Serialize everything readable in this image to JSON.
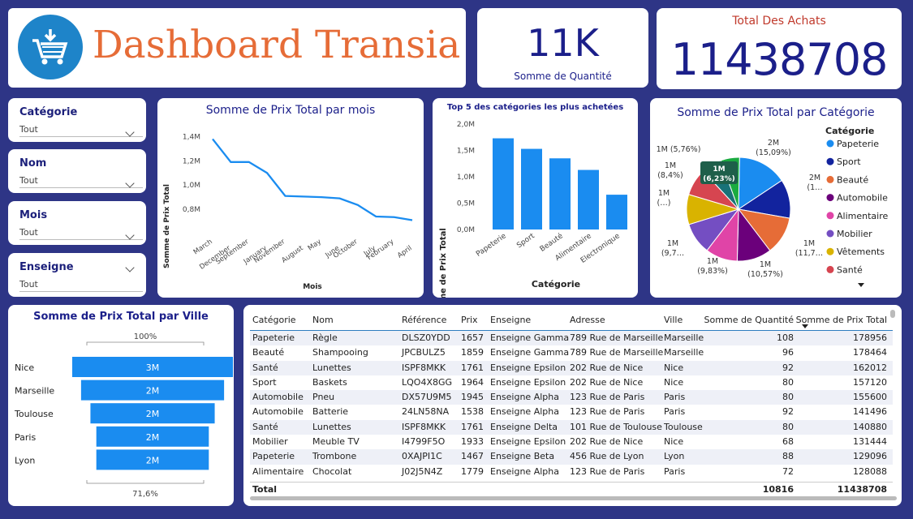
{
  "header": {
    "title": "Dashboard Transia",
    "icon": "shopping-cart-download-icon"
  },
  "kpi_quantity": {
    "value": "11K",
    "label": "Somme de Quantité"
  },
  "kpi_total": {
    "label": "Total Des Achats",
    "value": "11438708"
  },
  "slicers": [
    {
      "title": "Catégorie",
      "value": "Tout"
    },
    {
      "title": "Nom",
      "value": "Tout"
    },
    {
      "title": "Mois",
      "value": "Tout"
    },
    {
      "title": "Enseigne",
      "value": "Tout"
    }
  ],
  "line_chart": {
    "title": "Somme de Prix Total par mois",
    "ylabel": "Somme de Prix Total",
    "xlabel": "Mois",
    "yticks": [
      "1,4M",
      "1,2M",
      "1,0M",
      "0,8M"
    ],
    "categories": [
      "March",
      "December",
      "September",
      "January",
      "November",
      "August",
      "May",
      "June",
      "October",
      "July",
      "February",
      "April"
    ]
  },
  "bar_chart": {
    "title": "Top 5 des catégories les plus achetées",
    "ylabel": "Somme de Prix Total",
    "xlabel": "Catégorie",
    "yticks": [
      "2,0M",
      "1,5M",
      "1,0M",
      "0,5M",
      "0,0M"
    ],
    "color": "#1a8cf0"
  },
  "pie_chart": {
    "title": "Somme de Prix Total par Catégorie",
    "legend_title": "Catégorie",
    "labels": [
      "2M\n(15,09%)",
      "2M\n(1…",
      "1M\n(11,7…",
      "1M\n(10,57%)",
      "1M\n(9,83%)",
      "1M\n(9,7…",
      "1M\n(…)",
      "1M\n(8,4%)",
      "1M (5,76%)"
    ],
    "tooltip_line1": "1M",
    "tooltip_line2": "(6,23%)"
  },
  "funnel": {
    "title": "Somme de Prix Total par Ville",
    "top_pct": "100%",
    "bottom_pct": "71,6%",
    "color": "#1a8cf0"
  },
  "table": {
    "headers": [
      "Catégorie",
      "Nom",
      "Référence",
      "Prix",
      "Enseigne",
      "Adresse",
      "Ville",
      "Somme de Quantité",
      "Somme de Prix Total"
    ],
    "rows": [
      [
        "Papeterie",
        "Règle",
        "DLSZ0YDD",
        "1657",
        "Enseigne Gamma",
        "789 Rue de Marseille",
        "Marseille",
        "108",
        "178956"
      ],
      [
        "Beauté",
        "Shampooing",
        "JPCBULZ5",
        "1859",
        "Enseigne Gamma",
        "789 Rue de Marseille",
        "Marseille",
        "96",
        "178464"
      ],
      [
        "Santé",
        "Lunettes",
        "ISPF8MKK",
        "1761",
        "Enseigne Epsilon",
        "202 Rue de Nice",
        "Nice",
        "92",
        "162012"
      ],
      [
        "Sport",
        "Baskets",
        "LQO4X8GG",
        "1964",
        "Enseigne Epsilon",
        "202 Rue de Nice",
        "Nice",
        "80",
        "157120"
      ],
      [
        "Automobile",
        "Pneu",
        "DX57U9M5",
        "1945",
        "Enseigne Alpha",
        "123 Rue de Paris",
        "Paris",
        "80",
        "155600"
      ],
      [
        "Automobile",
        "Batterie",
        "24LN58NA",
        "1538",
        "Enseigne Alpha",
        "123 Rue de Paris",
        "Paris",
        "92",
        "141496"
      ],
      [
        "Santé",
        "Lunettes",
        "ISPF8MKK",
        "1761",
        "Enseigne Delta",
        "101 Rue de Toulouse",
        "Toulouse",
        "80",
        "140880"
      ],
      [
        "Mobilier",
        "Meuble TV",
        "I4799F5O",
        "1933",
        "Enseigne Epsilon",
        "202 Rue de Nice",
        "Nice",
        "68",
        "131444"
      ],
      [
        "Papeterie",
        "Trombone",
        "0XAJPI1C",
        "1467",
        "Enseigne Beta",
        "456 Rue de Lyon",
        "Lyon",
        "88",
        "129096"
      ],
      [
        "Alimentaire",
        "Chocolat",
        "J02J5N4Z",
        "1779",
        "Enseigne Alpha",
        "123 Rue de Paris",
        "Paris",
        "72",
        "128088"
      ]
    ],
    "total": {
      "label": "Total",
      "quantity": "10816",
      "prix": "11438708"
    }
  },
  "chart_data": [
    {
      "type": "line",
      "title": "Somme de Prix Total par mois",
      "xlabel": "Mois",
      "ylabel": "Somme de Prix Total",
      "categories": [
        "March",
        "December",
        "September",
        "January",
        "November",
        "August",
        "May",
        "June",
        "October",
        "July",
        "February",
        "April"
      ],
      "values": [
        1.38,
        1.19,
        1.19,
        1.1,
        0.91,
        0.905,
        0.9,
        0.89,
        0.835,
        0.74,
        0.735,
        0.71
      ],
      "unit": "M",
      "ylim": [
        0.7,
        1.45
      ]
    },
    {
      "type": "bar",
      "title": "Top 5 des catégories les plus achetées",
      "xlabel": "Catégorie",
      "ylabel": "Somme de Prix Total",
      "categories": [
        "Papeterie",
        "Sport",
        "Beauté",
        "Alimentaire",
        "Electronique"
      ],
      "values": [
        1.73,
        1.53,
        1.35,
        1.13,
        0.66
      ],
      "unit": "M",
      "ylim": [
        0,
        2.0
      ]
    },
    {
      "type": "pie",
      "title": "Somme de Prix Total par Catégorie",
      "categories": [
        "Papeterie",
        "Sport",
        "Beauté",
        "Automobile",
        "Alimentaire",
        "Mobilier",
        "Vêtements",
        "Santé"
      ],
      "values": [
        15.09,
        11.93,
        11.7,
        10.57,
        9.83,
        9.7,
        9.2,
        8.4,
        6.23,
        5.76
      ],
      "colors": [
        "#1a8cf0",
        "#12239e",
        "#e66c37",
        "#6b007b",
        "#e044a7",
        "#744ec2",
        "#d9b300",
        "#d64550",
        "#197278",
        "#1aab40"
      ]
    },
    {
      "type": "bar",
      "orientation": "funnel",
      "title": "Somme de Prix Total par Ville",
      "categories": [
        "Nice",
        "Marseille",
        "Toulouse",
        "Paris",
        "Lyon"
      ],
      "values": [
        3,
        2.67,
        2.32,
        2.1,
        2.1
      ],
      "labels": [
        "3M",
        "2M",
        "2M",
        "2M",
        "2M"
      ],
      "unit": "M"
    }
  ]
}
